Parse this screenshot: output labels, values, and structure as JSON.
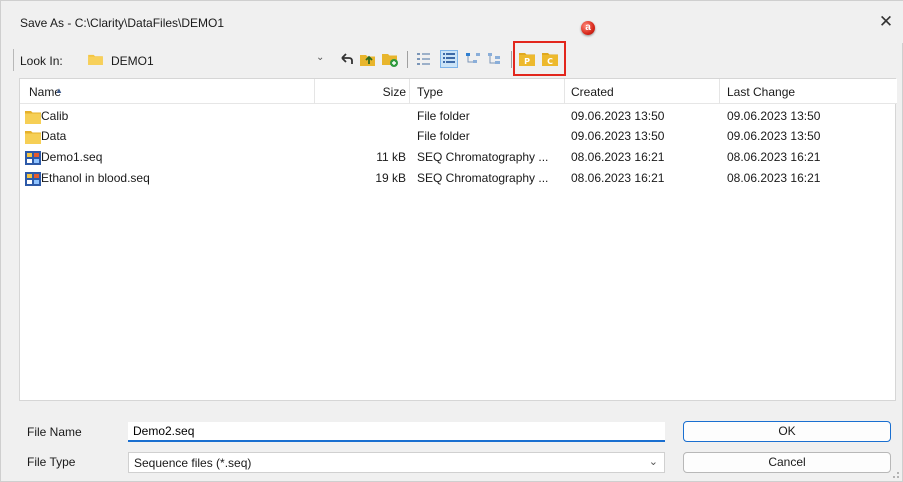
{
  "window": {
    "title": "Save As - C:\\Clarity\\DataFiles\\DEMO1",
    "close_label": "✕",
    "annotation_badge": "a"
  },
  "toolbar": {
    "look_in_label": "Look In:",
    "current_folder": "DEMO1",
    "buttons": [
      {
        "name": "back-icon"
      },
      {
        "name": "up-folder-icon"
      },
      {
        "name": "new-folder-icon"
      },
      {
        "name": "list-view-icon"
      },
      {
        "name": "details-view-icon"
      },
      {
        "name": "tree-view-icon"
      },
      {
        "name": "tree-view-alt-icon"
      },
      {
        "name": "project-folder-icon",
        "letter": "P"
      },
      {
        "name": "common-folder-icon",
        "letter": "C"
      }
    ],
    "highlight_color": "#e2261c"
  },
  "list": {
    "columns": {
      "name": "Name",
      "size": "Size",
      "type": "Type",
      "created": "Created",
      "last_change": "Last Change"
    },
    "rows": [
      {
        "icon": "folder-icon",
        "name": "Calib",
        "size": "",
        "type": "File folder",
        "created": "09.06.2023 13:50",
        "last_change": "09.06.2023 13:50"
      },
      {
        "icon": "folder-icon",
        "name": "Data",
        "size": "",
        "type": "File folder",
        "created": "09.06.2023 13:50",
        "last_change": "09.06.2023 13:50"
      },
      {
        "icon": "sequence-file-icon",
        "name": "Demo1.seq",
        "size": "11 kB",
        "type": "SEQ Chromatography ...",
        "created": "08.06.2023 16:21",
        "last_change": "08.06.2023 16:21"
      },
      {
        "icon": "sequence-file-icon",
        "name": "Ethanol in blood.seq",
        "size": "19 kB",
        "type": "SEQ Chromatography ...",
        "created": "08.06.2023 16:21",
        "last_change": "08.06.2023 16:21"
      }
    ]
  },
  "footer": {
    "file_name_label": "File Name",
    "file_name_value": "Demo2.seq",
    "file_type_label": "File Type",
    "file_type_value": "Sequence files (*.seq)",
    "ok_label": "OK",
    "cancel_label": "Cancel"
  },
  "colors": {
    "accent": "#1a6fd0",
    "folder": "#f4c542",
    "seq_icon": "#2d5aa8"
  }
}
